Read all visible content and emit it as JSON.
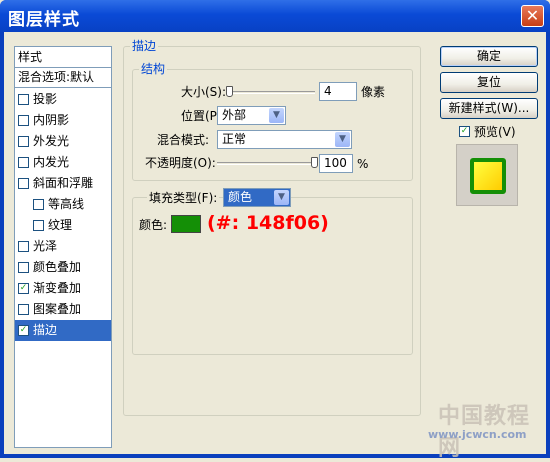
{
  "window": {
    "title": "图层样式"
  },
  "list": {
    "header": "样式",
    "blend_default": "混合选项:默认",
    "items": [
      {
        "label": "投影",
        "checked": false
      },
      {
        "label": "内阴影",
        "checked": false
      },
      {
        "label": "外发光",
        "checked": false
      },
      {
        "label": "内发光",
        "checked": false
      },
      {
        "label": "斜面和浮雕",
        "checked": false
      },
      {
        "label": "等高线",
        "checked": false
      },
      {
        "label": "纹理",
        "checked": false
      },
      {
        "label": "光泽",
        "checked": false
      },
      {
        "label": "颜色叠加",
        "checked": false
      },
      {
        "label": "渐变叠加",
        "checked": true
      },
      {
        "label": "图案叠加",
        "checked": false
      },
      {
        "label": "描边",
        "checked": true
      }
    ]
  },
  "stroke": {
    "group_title": "描边",
    "structure_title": "结构",
    "size_label": "大小(S):",
    "size_value": "4",
    "size_unit": "像素",
    "position_label": "位置(P):",
    "position_value": "外部",
    "blend_label": "混合模式:",
    "blend_value": "正常",
    "opacity_label": "不透明度(O):",
    "opacity_value": "100",
    "opacity_unit": "%",
    "fill_type_label": "填充类型(F):",
    "fill_type_value": "颜色",
    "color_label": "颜色:",
    "color_hex": "#148f06",
    "annotation": "(#: 148f06)"
  },
  "buttons": {
    "ok": "确定",
    "reset": "复位",
    "new_style": "新建样式(W)...",
    "preview_label": "预览(V)",
    "preview_checked": true
  },
  "watermark": {
    "line1": "中国教程网",
    "line2": "www.jcwcn.com"
  }
}
